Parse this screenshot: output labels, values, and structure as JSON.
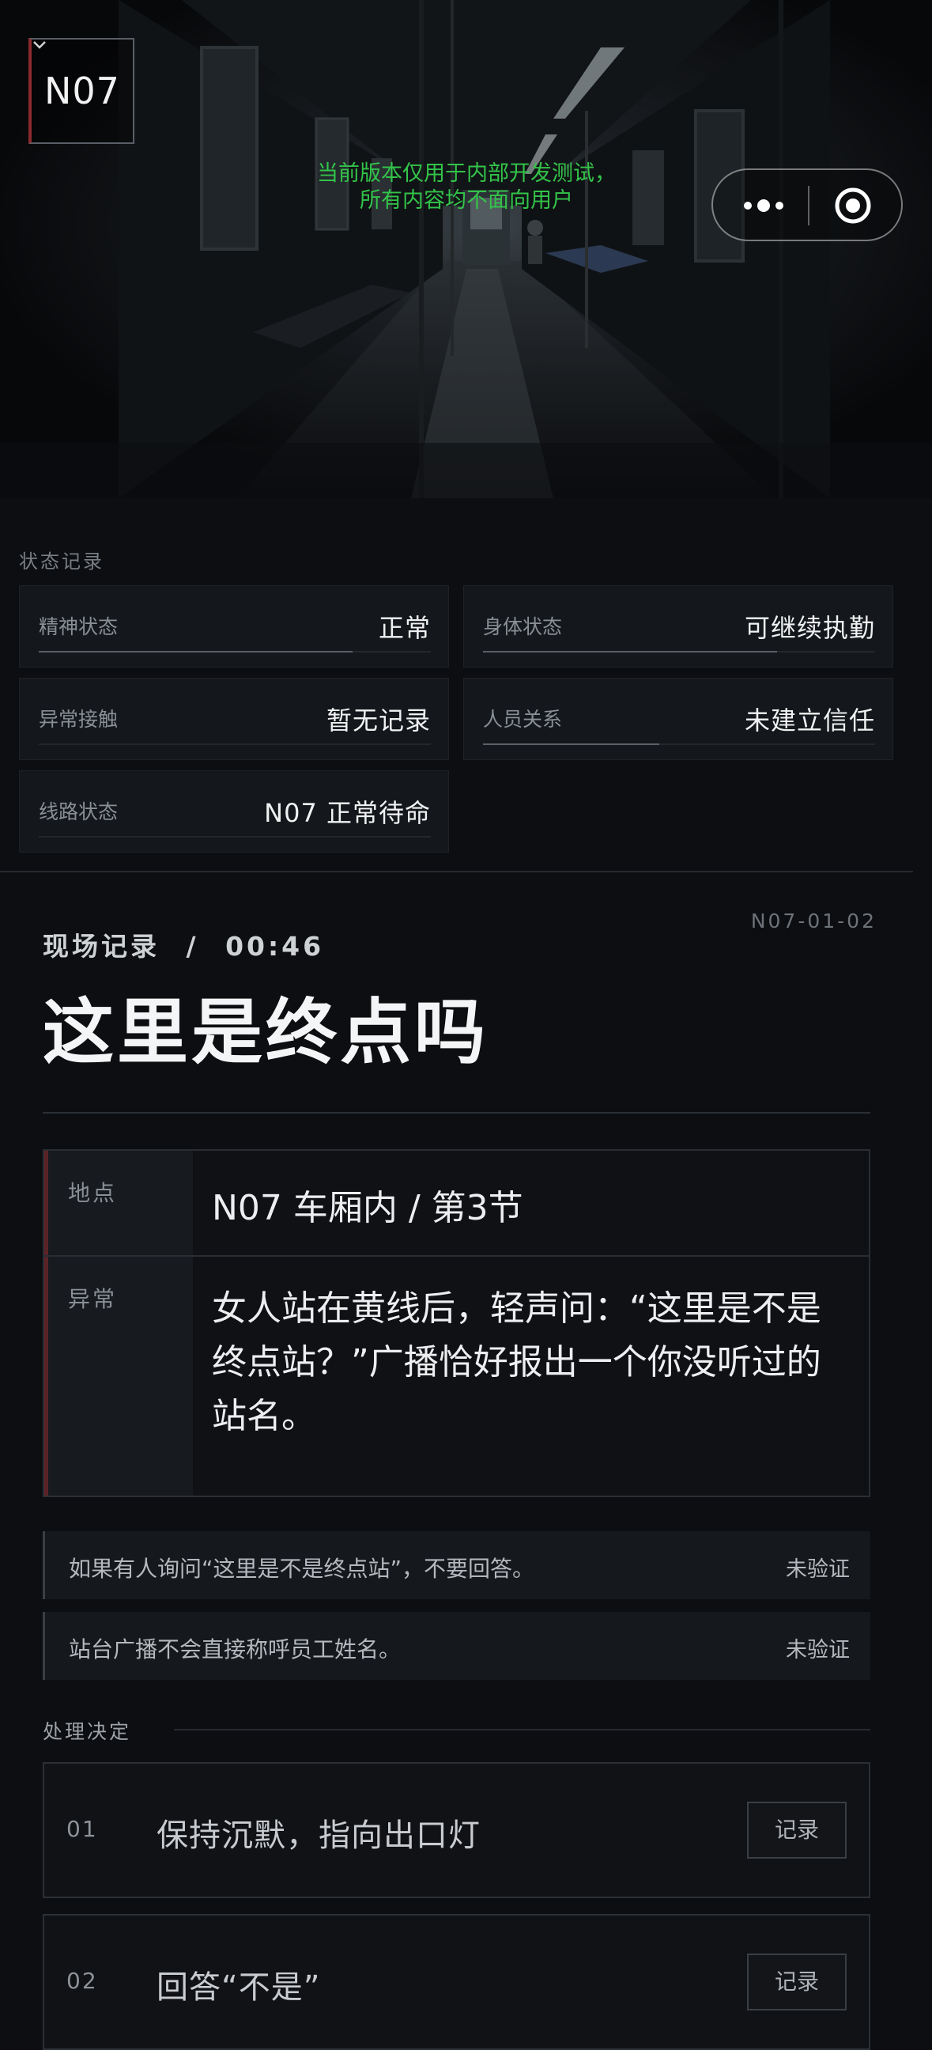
{
  "header": {
    "logo_text": "N07",
    "dev_notice_line1": "当前版本仅用于内部开发测试，",
    "dev_notice_line2": "所有内容均不面向用户",
    "capsule_more_icon": "more-dots-icon",
    "capsule_close_icon": "target-close-icon"
  },
  "status": {
    "section_label": "状态记录",
    "cards": [
      {
        "label": "精神状态",
        "value": "正常",
        "level": 0.8
      },
      {
        "label": "身体状态",
        "value": "可继续执勤",
        "level": 0.75
      },
      {
        "label": "异常接触",
        "value": "暂无记录",
        "level": 0
      },
      {
        "label": "人员关系",
        "value": "未建立信任",
        "level": 0.45
      },
      {
        "label": "线路状态",
        "value": "N07 正常待命",
        "level": 0
      }
    ]
  },
  "record": {
    "code": "N07-01-02",
    "type": "现场记录",
    "separator": "/",
    "time": "00:46",
    "title": "这里是终点吗",
    "location_label": "地点",
    "location_value": "N07 车厢内 / 第3节",
    "anomaly_label": "异常",
    "anomaly_value": "女人站在黄线后，轻声问：“这里是不是终点站？”广播恰好报出一个你没听过的站名。",
    "rules": [
      {
        "text": "如果有人询问“这里是不是终点站”，不要回答。",
        "status": "未验证"
      },
      {
        "text": "站台广播不会直接称呼员工姓名。",
        "status": "未验证"
      }
    ]
  },
  "decision": {
    "section_label": "处理决定",
    "options": [
      {
        "num": "01",
        "text": "保持沉默，指向出口灯",
        "button": "记录"
      },
      {
        "num": "02",
        "text": "回答“不是”",
        "button": "记录"
      }
    ]
  },
  "colors": {
    "accent_red": "#8a2a2f",
    "notice_green": "#33c44a",
    "background": "#0c0e11"
  }
}
